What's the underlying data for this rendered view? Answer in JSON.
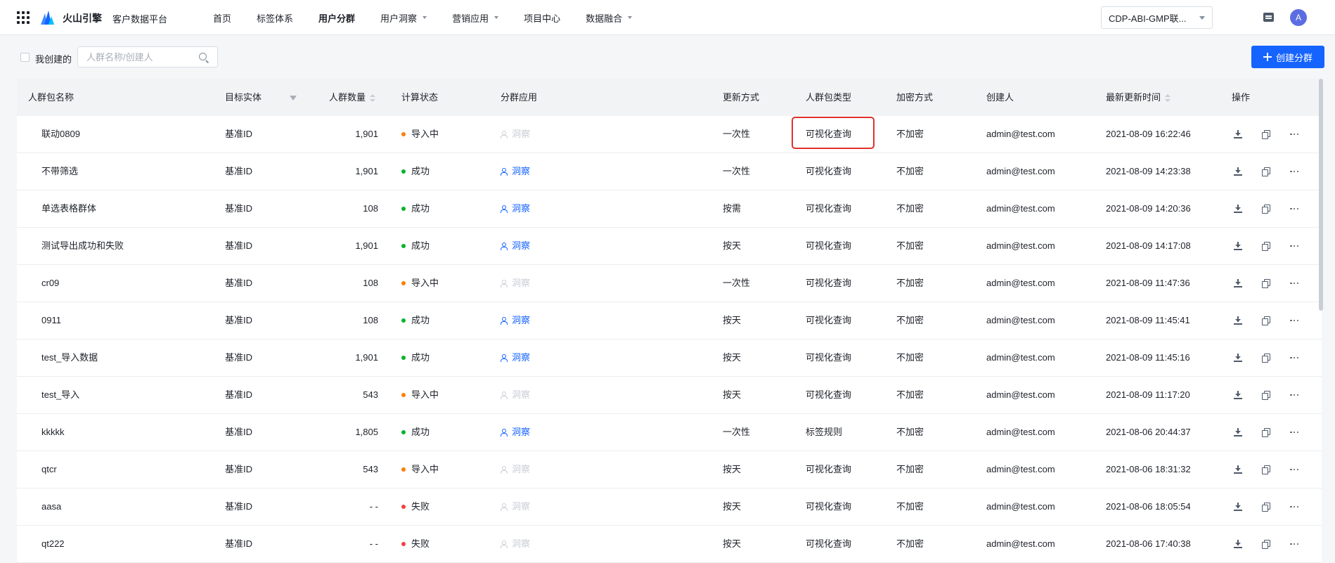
{
  "header": {
    "brand": "火山引擎",
    "platform": "客户数据平台",
    "nav": [
      {
        "label": "首页",
        "active": false,
        "dropdown": false
      },
      {
        "label": "标签体系",
        "active": false,
        "dropdown": false
      },
      {
        "label": "用户分群",
        "active": true,
        "dropdown": false
      },
      {
        "label": "用户洞察",
        "active": false,
        "dropdown": true
      },
      {
        "label": "营销应用",
        "active": false,
        "dropdown": true
      },
      {
        "label": "项目中心",
        "active": false,
        "dropdown": false
      },
      {
        "label": "数据融合",
        "active": false,
        "dropdown": true
      }
    ],
    "tenant": "CDP-ABI-GMP联...",
    "avatar": "A"
  },
  "toolbar": {
    "my_created_label": "我创建的",
    "search_placeholder": "人群名称/创建人",
    "create_label": "创建分群"
  },
  "table": {
    "columns": {
      "name": "人群包名称",
      "entity": "目标实体",
      "count": "人群数量",
      "status": "计算状态",
      "app": "分群应用",
      "update": "更新方式",
      "type": "人群包类型",
      "encrypt": "加密方式",
      "creator": "创建人",
      "time": "最新更新时间",
      "ops": "操作"
    },
    "rows": [
      {
        "name": "联动0809",
        "entity": "基准ID",
        "count": "1,901",
        "status": "导入中",
        "status_color": "#ff7d00",
        "app": "洞察",
        "app_enabled": false,
        "update": "一次性",
        "type": "可视化查询",
        "encrypt": "不加密",
        "creator": "admin@test.com",
        "time": "2021-08-09 16:22:46"
      },
      {
        "name": "不带筛选",
        "entity": "基准ID",
        "count": "1,901",
        "status": "成功",
        "status_color": "#00b42a",
        "app": "洞察",
        "app_enabled": true,
        "update": "一次性",
        "type": "可视化查询",
        "encrypt": "不加密",
        "creator": "admin@test.com",
        "time": "2021-08-09 14:23:38"
      },
      {
        "name": "单选表格群体",
        "entity": "基准ID",
        "count": "108",
        "status": "成功",
        "status_color": "#00b42a",
        "app": "洞察",
        "app_enabled": true,
        "update": "按需",
        "type": "可视化查询",
        "encrypt": "不加密",
        "creator": "admin@test.com",
        "time": "2021-08-09 14:20:36"
      },
      {
        "name": "测试导出成功和失败",
        "entity": "基准ID",
        "count": "1,901",
        "status": "成功",
        "status_color": "#00b42a",
        "app": "洞察",
        "app_enabled": true,
        "update": "按天",
        "type": "可视化查询",
        "encrypt": "不加密",
        "creator": "admin@test.com",
        "time": "2021-08-09 14:17:08"
      },
      {
        "name": "cr09",
        "entity": "基准ID",
        "count": "108",
        "status": "导入中",
        "status_color": "#ff7d00",
        "app": "洞察",
        "app_enabled": false,
        "update": "一次性",
        "type": "可视化查询",
        "encrypt": "不加密",
        "creator": "admin@test.com",
        "time": "2021-08-09 11:47:36"
      },
      {
        "name": "0911",
        "entity": "基准ID",
        "count": "108",
        "status": "成功",
        "status_color": "#00b42a",
        "app": "洞察",
        "app_enabled": true,
        "update": "按天",
        "type": "可视化查询",
        "encrypt": "不加密",
        "creator": "admin@test.com",
        "time": "2021-08-09 11:45:41"
      },
      {
        "name": "test_导入数据",
        "entity": "基准ID",
        "count": "1,901",
        "status": "成功",
        "status_color": "#00b42a",
        "app": "洞察",
        "app_enabled": true,
        "update": "按天",
        "type": "可视化查询",
        "encrypt": "不加密",
        "creator": "admin@test.com",
        "time": "2021-08-09 11:45:16"
      },
      {
        "name": "test_导入",
        "entity": "基准ID",
        "count": "543",
        "status": "导入中",
        "status_color": "#ff7d00",
        "app": "洞察",
        "app_enabled": false,
        "update": "按天",
        "type": "可视化查询",
        "encrypt": "不加密",
        "creator": "admin@test.com",
        "time": "2021-08-09 11:17:20"
      },
      {
        "name": "kkkkk",
        "entity": "基准ID",
        "count": "1,805",
        "status": "成功",
        "status_color": "#00b42a",
        "app": "洞察",
        "app_enabled": true,
        "update": "一次性",
        "type": "标签规则",
        "encrypt": "不加密",
        "creator": "admin@test.com",
        "time": "2021-08-06 20:44:37"
      },
      {
        "name": "qtcr",
        "entity": "基准ID",
        "count": "543",
        "status": "导入中",
        "status_color": "#ff7d00",
        "app": "洞察",
        "app_enabled": false,
        "update": "按天",
        "type": "可视化查询",
        "encrypt": "不加密",
        "creator": "admin@test.com",
        "time": "2021-08-06 18:31:32"
      },
      {
        "name": "aasa",
        "entity": "基准ID",
        "count": "- -",
        "status": "失败",
        "status_color": "#f53f3f",
        "app": "洞察",
        "app_enabled": false,
        "update": "按天",
        "type": "可视化查询",
        "encrypt": "不加密",
        "creator": "admin@test.com",
        "time": "2021-08-06 18:05:54"
      },
      {
        "name": "qt222",
        "entity": "基准ID",
        "count": "- -",
        "status": "失败",
        "status_color": "#f53f3f",
        "app": "洞察",
        "app_enabled": false,
        "update": "按天",
        "type": "可视化查询",
        "encrypt": "不加密",
        "creator": "admin@test.com",
        "time": "2021-08-06 17:40:38"
      }
    ]
  },
  "colors": {
    "accent": "#1664ff",
    "highlight_border": "#e0312b"
  }
}
